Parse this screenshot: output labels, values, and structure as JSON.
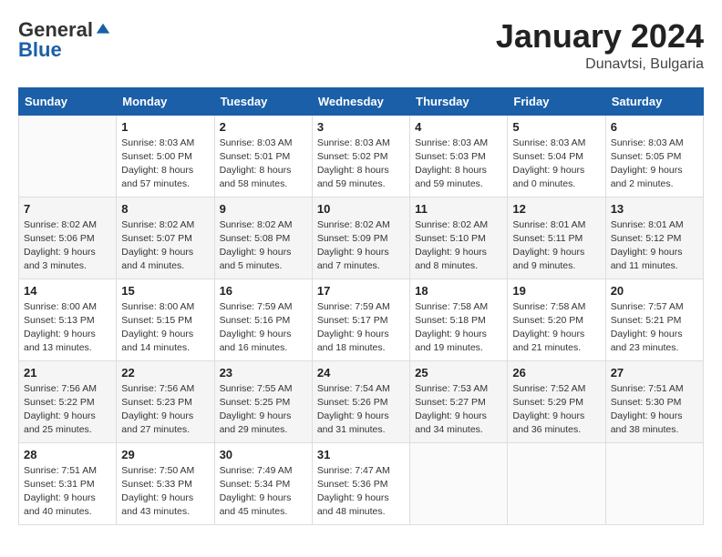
{
  "header": {
    "logo_general": "General",
    "logo_blue": "Blue",
    "title": "January 2024",
    "subtitle": "Dunavtsi, Bulgaria"
  },
  "days_of_week": [
    "Sunday",
    "Monday",
    "Tuesday",
    "Wednesday",
    "Thursday",
    "Friday",
    "Saturday"
  ],
  "weeks": [
    [
      {
        "day": "",
        "sunrise": "",
        "sunset": "",
        "daylight": ""
      },
      {
        "day": "1",
        "sunrise": "Sunrise: 8:03 AM",
        "sunset": "Sunset: 5:00 PM",
        "daylight": "Daylight: 8 hours and 57 minutes."
      },
      {
        "day": "2",
        "sunrise": "Sunrise: 8:03 AM",
        "sunset": "Sunset: 5:01 PM",
        "daylight": "Daylight: 8 hours and 58 minutes."
      },
      {
        "day": "3",
        "sunrise": "Sunrise: 8:03 AM",
        "sunset": "Sunset: 5:02 PM",
        "daylight": "Daylight: 8 hours and 59 minutes."
      },
      {
        "day": "4",
        "sunrise": "Sunrise: 8:03 AM",
        "sunset": "Sunset: 5:03 PM",
        "daylight": "Daylight: 8 hours and 59 minutes."
      },
      {
        "day": "5",
        "sunrise": "Sunrise: 8:03 AM",
        "sunset": "Sunset: 5:04 PM",
        "daylight": "Daylight: 9 hours and 0 minutes."
      },
      {
        "day": "6",
        "sunrise": "Sunrise: 8:03 AM",
        "sunset": "Sunset: 5:05 PM",
        "daylight": "Daylight: 9 hours and 2 minutes."
      }
    ],
    [
      {
        "day": "7",
        "sunrise": "Sunrise: 8:02 AM",
        "sunset": "Sunset: 5:06 PM",
        "daylight": "Daylight: 9 hours and 3 minutes."
      },
      {
        "day": "8",
        "sunrise": "Sunrise: 8:02 AM",
        "sunset": "Sunset: 5:07 PM",
        "daylight": "Daylight: 9 hours and 4 minutes."
      },
      {
        "day": "9",
        "sunrise": "Sunrise: 8:02 AM",
        "sunset": "Sunset: 5:08 PM",
        "daylight": "Daylight: 9 hours and 5 minutes."
      },
      {
        "day": "10",
        "sunrise": "Sunrise: 8:02 AM",
        "sunset": "Sunset: 5:09 PM",
        "daylight": "Daylight: 9 hours and 7 minutes."
      },
      {
        "day": "11",
        "sunrise": "Sunrise: 8:02 AM",
        "sunset": "Sunset: 5:10 PM",
        "daylight": "Daylight: 9 hours and 8 minutes."
      },
      {
        "day": "12",
        "sunrise": "Sunrise: 8:01 AM",
        "sunset": "Sunset: 5:11 PM",
        "daylight": "Daylight: 9 hours and 9 minutes."
      },
      {
        "day": "13",
        "sunrise": "Sunrise: 8:01 AM",
        "sunset": "Sunset: 5:12 PM",
        "daylight": "Daylight: 9 hours and 11 minutes."
      }
    ],
    [
      {
        "day": "14",
        "sunrise": "Sunrise: 8:00 AM",
        "sunset": "Sunset: 5:13 PM",
        "daylight": "Daylight: 9 hours and 13 minutes."
      },
      {
        "day": "15",
        "sunrise": "Sunrise: 8:00 AM",
        "sunset": "Sunset: 5:15 PM",
        "daylight": "Daylight: 9 hours and 14 minutes."
      },
      {
        "day": "16",
        "sunrise": "Sunrise: 7:59 AM",
        "sunset": "Sunset: 5:16 PM",
        "daylight": "Daylight: 9 hours and 16 minutes."
      },
      {
        "day": "17",
        "sunrise": "Sunrise: 7:59 AM",
        "sunset": "Sunset: 5:17 PM",
        "daylight": "Daylight: 9 hours and 18 minutes."
      },
      {
        "day": "18",
        "sunrise": "Sunrise: 7:58 AM",
        "sunset": "Sunset: 5:18 PM",
        "daylight": "Daylight: 9 hours and 19 minutes."
      },
      {
        "day": "19",
        "sunrise": "Sunrise: 7:58 AM",
        "sunset": "Sunset: 5:20 PM",
        "daylight": "Daylight: 9 hours and 21 minutes."
      },
      {
        "day": "20",
        "sunrise": "Sunrise: 7:57 AM",
        "sunset": "Sunset: 5:21 PM",
        "daylight": "Daylight: 9 hours and 23 minutes."
      }
    ],
    [
      {
        "day": "21",
        "sunrise": "Sunrise: 7:56 AM",
        "sunset": "Sunset: 5:22 PM",
        "daylight": "Daylight: 9 hours and 25 minutes."
      },
      {
        "day": "22",
        "sunrise": "Sunrise: 7:56 AM",
        "sunset": "Sunset: 5:23 PM",
        "daylight": "Daylight: 9 hours and 27 minutes."
      },
      {
        "day": "23",
        "sunrise": "Sunrise: 7:55 AM",
        "sunset": "Sunset: 5:25 PM",
        "daylight": "Daylight: 9 hours and 29 minutes."
      },
      {
        "day": "24",
        "sunrise": "Sunrise: 7:54 AM",
        "sunset": "Sunset: 5:26 PM",
        "daylight": "Daylight: 9 hours and 31 minutes."
      },
      {
        "day": "25",
        "sunrise": "Sunrise: 7:53 AM",
        "sunset": "Sunset: 5:27 PM",
        "daylight": "Daylight: 9 hours and 34 minutes."
      },
      {
        "day": "26",
        "sunrise": "Sunrise: 7:52 AM",
        "sunset": "Sunset: 5:29 PM",
        "daylight": "Daylight: 9 hours and 36 minutes."
      },
      {
        "day": "27",
        "sunrise": "Sunrise: 7:51 AM",
        "sunset": "Sunset: 5:30 PM",
        "daylight": "Daylight: 9 hours and 38 minutes."
      }
    ],
    [
      {
        "day": "28",
        "sunrise": "Sunrise: 7:51 AM",
        "sunset": "Sunset: 5:31 PM",
        "daylight": "Daylight: 9 hours and 40 minutes."
      },
      {
        "day": "29",
        "sunrise": "Sunrise: 7:50 AM",
        "sunset": "Sunset: 5:33 PM",
        "daylight": "Daylight: 9 hours and 43 minutes."
      },
      {
        "day": "30",
        "sunrise": "Sunrise: 7:49 AM",
        "sunset": "Sunset: 5:34 PM",
        "daylight": "Daylight: 9 hours and 45 minutes."
      },
      {
        "day": "31",
        "sunrise": "Sunrise: 7:47 AM",
        "sunset": "Sunset: 5:36 PM",
        "daylight": "Daylight: 9 hours and 48 minutes."
      },
      {
        "day": "",
        "sunrise": "",
        "sunset": "",
        "daylight": ""
      },
      {
        "day": "",
        "sunrise": "",
        "sunset": "",
        "daylight": ""
      },
      {
        "day": "",
        "sunrise": "",
        "sunset": "",
        "daylight": ""
      }
    ]
  ]
}
